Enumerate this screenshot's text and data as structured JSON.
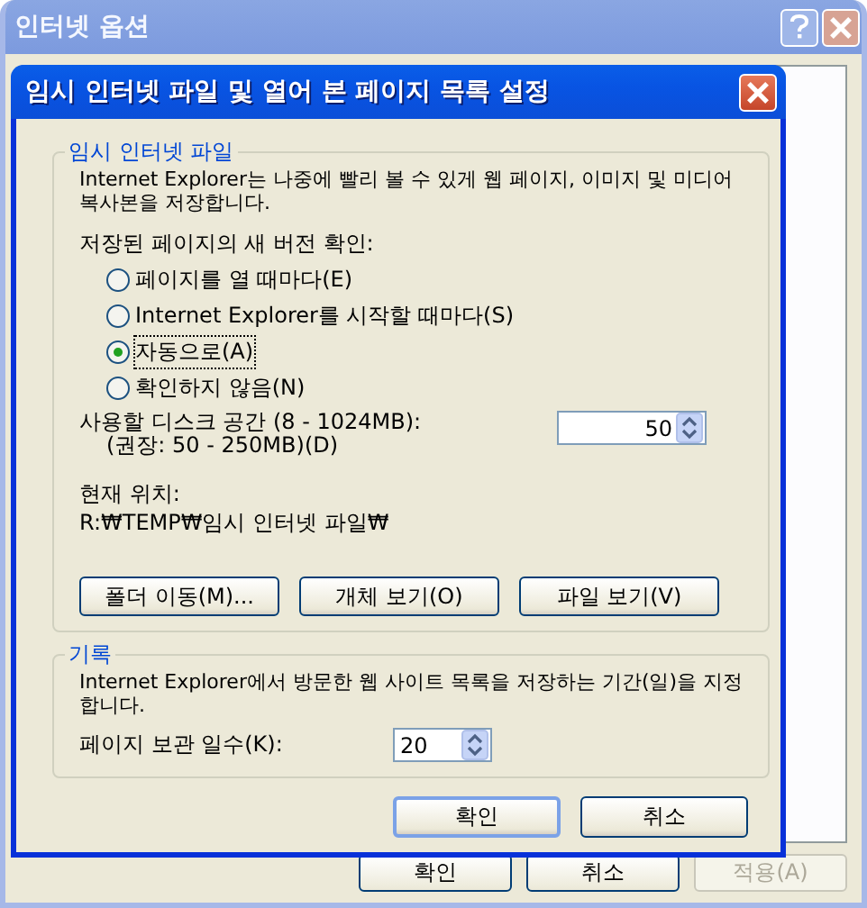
{
  "back_window": {
    "title": "인터넷 옵션",
    "buttons": [
      {
        "label": "확인",
        "disabled": false
      },
      {
        "label": "취소",
        "disabled": false
      },
      {
        "label": "적용(A)",
        "disabled": true
      }
    ]
  },
  "dialog": {
    "title": "임시 인터넷 파일 및 열어 본 페이지 목록 설정",
    "temp_files": {
      "legend": "임시 인터넷 파일",
      "description": "Internet Explorer는 나중에 빨리 볼 수 있게 웹 페이지, 이미지 및 미디어 복사본을 저장합니다.",
      "check_label": "저장된 페이지의 새 버전 확인:",
      "options": [
        {
          "label": "페이지를 열 때마다(E)",
          "selected": false
        },
        {
          "label": "Internet Explorer를 시작할 때마다(S)",
          "selected": false
        },
        {
          "label": "자동으로(A)",
          "selected": true
        },
        {
          "label": "확인하지 않음(N)",
          "selected": false
        }
      ],
      "disk_label": "사용할 디스크 공간 (8 - 1024MB):",
      "disk_hint": "(권장: 50 - 250MB)(D)",
      "disk_value": "50",
      "location_label": "현재 위치:",
      "location": "R:₩TEMP₩임시 인터넷 파일₩",
      "buttons": [
        "폴더 이동(M)...",
        "개체 보기(O)",
        "파일 보기(V)"
      ]
    },
    "history": {
      "legend": "기록",
      "description": "Internet Explorer에서 방문한 웹 사이트 목록을 저장하는 기간(일)을 지정합니다.",
      "days_label": "페이지 보관 일수(K):",
      "days_value": "20"
    },
    "buttons": [
      "확인",
      "취소"
    ]
  }
}
